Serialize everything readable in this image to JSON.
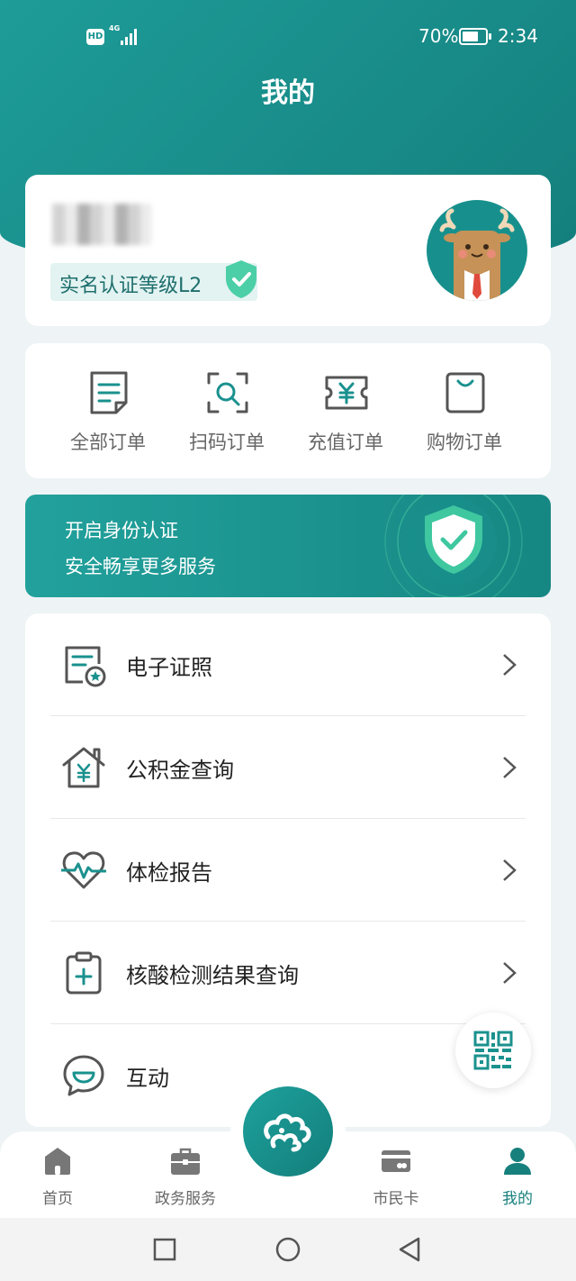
{
  "status_bar": {
    "hd": "HD",
    "network": "4G",
    "battery_text": "70%",
    "battery_level": 0.7,
    "time": "2:34"
  },
  "header": {
    "title": "我的"
  },
  "profile": {
    "username": "用户",
    "certification_label": "实名认证等级L2"
  },
  "orders": [
    {
      "label": "全部订单",
      "icon": "document-list-icon"
    },
    {
      "label": "扫码订单",
      "icon": "scan-search-icon"
    },
    {
      "label": "充值订单",
      "icon": "yuan-ticket-icon"
    },
    {
      "label": "购物订单",
      "icon": "shopping-bag-icon"
    }
  ],
  "banner": {
    "line1": "开启身份认证",
    "line2": "安全畅享更多服务"
  },
  "menu": [
    {
      "label": "电子证照",
      "icon": "e-license-icon"
    },
    {
      "label": "公积金查询",
      "icon": "house-fund-icon"
    },
    {
      "label": "体检报告",
      "icon": "health-heart-icon"
    },
    {
      "label": "核酸检测结果查询",
      "icon": "clipboard-medical-icon"
    },
    {
      "label": "互动",
      "icon": "chat-smile-icon"
    }
  ],
  "tabbar": {
    "items": [
      {
        "label": "首页",
        "icon": "home-icon"
      },
      {
        "label": "政务服务",
        "icon": "briefcase-icon"
      },
      {
        "label": "市民卡",
        "icon": "card-icon"
      },
      {
        "label": "我的",
        "icon": "user-icon"
      }
    ],
    "active": "我的"
  },
  "colors": {
    "primary": "#1a918e",
    "accent_green": "#4ccfa6",
    "background": "#eef3f5"
  }
}
